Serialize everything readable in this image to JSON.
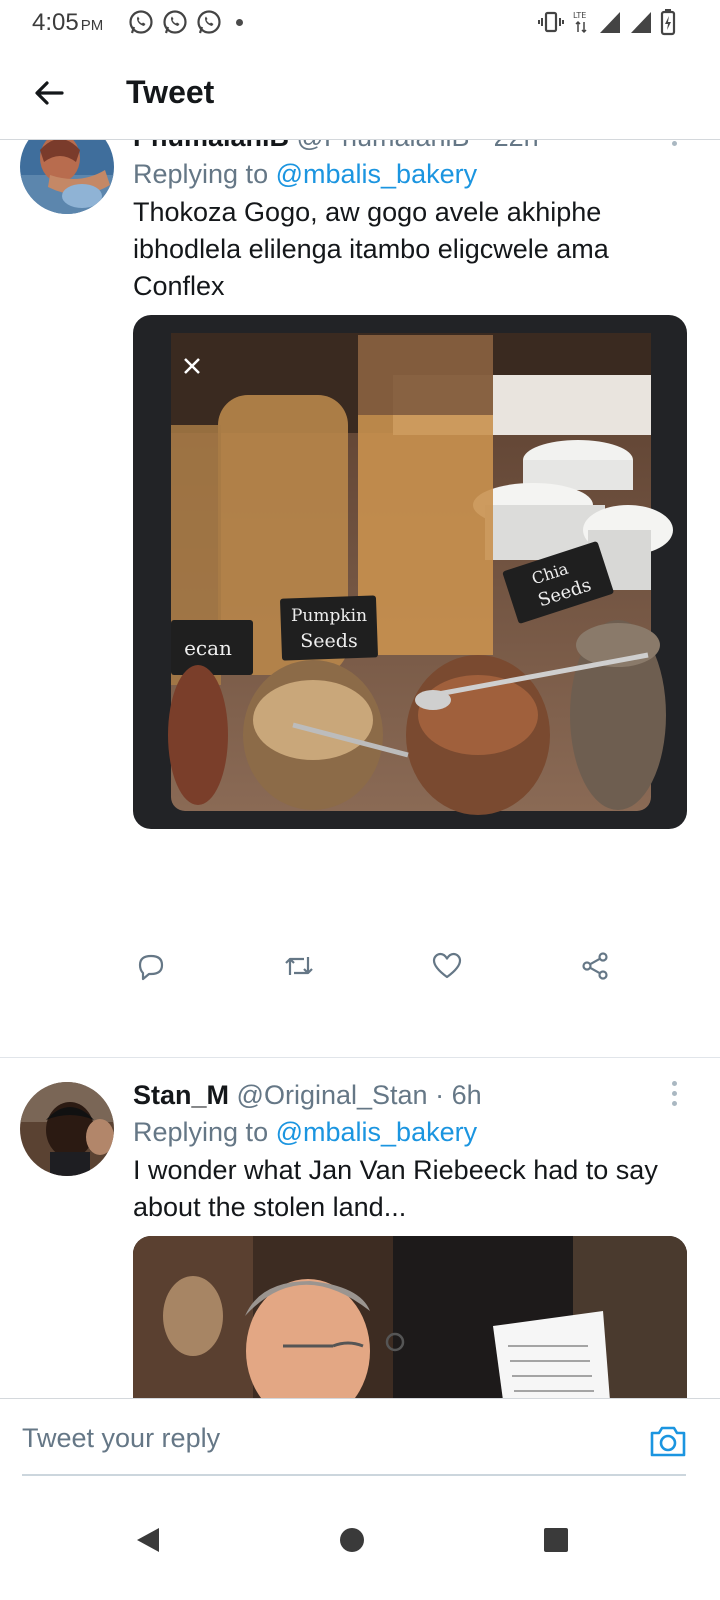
{
  "status_bar": {
    "time": "4:05",
    "ampm": "PM",
    "network": "LTE"
  },
  "header": {
    "title": "Tweet"
  },
  "tweets": [
    {
      "display_name": "PhumalaniB",
      "handle": "@PhumalaniB",
      "time": "22h",
      "replying_label": "Replying to",
      "replying_to": "@mbalis_bakery",
      "text": "Thokoza Gogo, aw gogo avele akhiphe ibhodlela elilenga itambo eligcwele ama Conflex",
      "media_labels": [
        "Pumpkin Seeds",
        "Chia Seeds",
        "Pecan"
      ]
    },
    {
      "display_name": "Stan_M",
      "handle": "@Original_Stan",
      "time": "6h",
      "replying_label": "Replying to",
      "replying_to": "@mbalis_bakery",
      "text": "I wonder what Jan Van Riebeeck had to say about the stolen land..."
    }
  ],
  "composer": {
    "placeholder": "Tweet your reply"
  },
  "colors": {
    "accent": "#1b95e0",
    "secondary_text": "#657786",
    "primary_text": "#14171a"
  },
  "icons": [
    "back-arrow-icon",
    "reply-icon",
    "retweet-icon",
    "like-icon",
    "share-icon",
    "camera-icon",
    "more-icon"
  ]
}
